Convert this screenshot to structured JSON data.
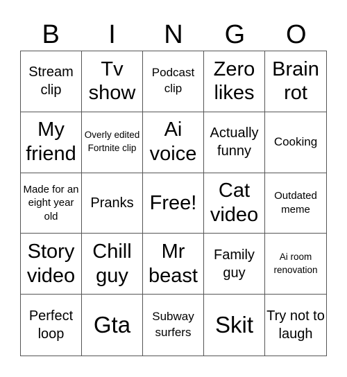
{
  "header": [
    "B",
    "I",
    "N",
    "G",
    "O"
  ],
  "cells": [
    {
      "text": "Stream clip",
      "size": "s-m"
    },
    {
      "text": "Tv show",
      "size": "s-l"
    },
    {
      "text": "Podcast clip",
      "size": "s-s"
    },
    {
      "text": "Zero likes",
      "size": "s-l"
    },
    {
      "text": "Brain rot",
      "size": "s-l"
    },
    {
      "text": "My friend",
      "size": "s-l"
    },
    {
      "text": "Overly edited Fortnite clip",
      "size": "s-xxs"
    },
    {
      "text": "Ai voice",
      "size": "s-l"
    },
    {
      "text": "Actually funny",
      "size": "s-m"
    },
    {
      "text": "Cooking",
      "size": "s-s"
    },
    {
      "text": "Made for an eight year old",
      "size": "s-xs"
    },
    {
      "text": "Pranks",
      "size": "s-m"
    },
    {
      "text": "Free!",
      "size": "s-l"
    },
    {
      "text": "Cat video",
      "size": "s-l"
    },
    {
      "text": "Outdated meme",
      "size": "s-xs"
    },
    {
      "text": "Story video",
      "size": "s-l"
    },
    {
      "text": "Chill guy",
      "size": "s-l"
    },
    {
      "text": "Mr beast",
      "size": "s-l"
    },
    {
      "text": "Family guy",
      "size": "s-m"
    },
    {
      "text": "Ai room renovation",
      "size": "s-xxs"
    },
    {
      "text": "Perfect loop",
      "size": "s-m"
    },
    {
      "text": "Gta",
      "size": "s-xl"
    },
    {
      "text": "Subway surfers",
      "size": "s-s"
    },
    {
      "text": "Skit",
      "size": "s-xl"
    },
    {
      "text": "Try not to laugh",
      "size": "s-m"
    }
  ]
}
